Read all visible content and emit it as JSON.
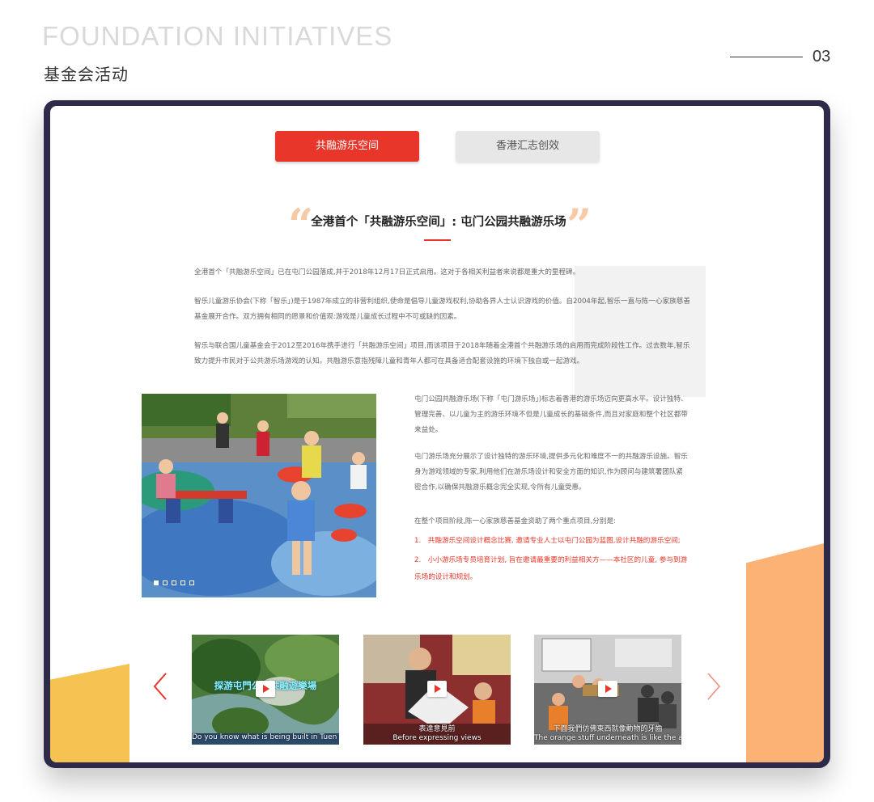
{
  "header": {
    "title_en": "FOUNDATION INITIATIVES",
    "title_cn": "基金会活动",
    "page_number": "03"
  },
  "tabs": [
    {
      "label": "共融游乐空间",
      "active": true
    },
    {
      "label": "香港汇志创效",
      "active": false
    }
  ],
  "article": {
    "title": "全港首个「共融游乐空间」: 屯门公园共融游乐场",
    "paragraphs": [
      "全港首个「共融游乐空间」已在屯门公园落成,并于2018年12月17日正式启用。这对于各相关利益者来说都是重大的里程碑。",
      "智乐儿童游乐协会(下称「智乐」)是于1987年成立的非营利组织,使命是倡导儿童游戏权利,协助各界人士认识游戏的价值。自2004年起,智乐一直与陈一心家族慈善基金展开合作。双方拥有相同的愿景和价值观:游戏是儿童成长过程中不可或缺的因素。",
      "智乐与联合国儿童基金会于2012至2016年携手进行「共融游乐空间」项目,而该项目于2018年随着全港首个共融游乐场的启用而完成阶段性工作。过去数年,智乐致力提升市民对于公共游乐场游戏的认知。共融游乐意指残障儿童和青年人都可在具备适合配套设施的环境下独自或一起游戏。"
    ],
    "side_paragraphs": [
      "屯门公园共融游乐场(下称「屯门游乐场」)标志着香港的游乐场迈向更高水平。设计独特、管理完善、以儿童为主的游乐环境不但是儿童成长的基础条件,而且对家庭和整个社区都带来益处。",
      "屯门游乐场充分展示了设计独特的游乐环境,提供多元化和难度不一的共融游乐设施。智乐身为游戏领域的专家,利用他们在游乐场设计和安全方面的知识,作为顾问与建筑署团队紧密合作,以确保共融游乐概念完全实现,令所有儿童受惠。",
      "在整个项目阶段,陈一心家族慈善基金资助了两个重点项目,分别是:"
    ],
    "highlights": [
      "1. 共融游乐空间设计概念比赛, 邀请专业人士以屯门公园为蓝图,设计共融的游乐空间;",
      "2. 小小游乐场专员培育计划, 旨在邀请最重要的利益相关方——本社区的儿童, 参与到游乐场的设计和规划。"
    ],
    "slider_count": 5,
    "slider_active": 1
  },
  "videos": [
    {
      "banner": "探游屯門公園共融遊樂場",
      "caption": "Do you know what is being built in Tuen Mun Park?"
    },
    {
      "banner": "",
      "caption_cn": "表達意見前",
      "caption": "Before expressing views"
    },
    {
      "banner": "",
      "caption_cn": "下面我們仿佛東西就像動物的牙齒",
      "caption": "The orange stuff underneath is like the animal's teeth"
    }
  ],
  "colors": {
    "accent": "#e8372a",
    "frame": "#2e2a4a",
    "deco_yellow": "#f6c352",
    "deco_orange": "#fbb274",
    "quote": "#f7c9a4"
  },
  "icons": {
    "prev": "chevron-left-icon",
    "next": "chevron-right-icon",
    "play": "play-icon"
  }
}
